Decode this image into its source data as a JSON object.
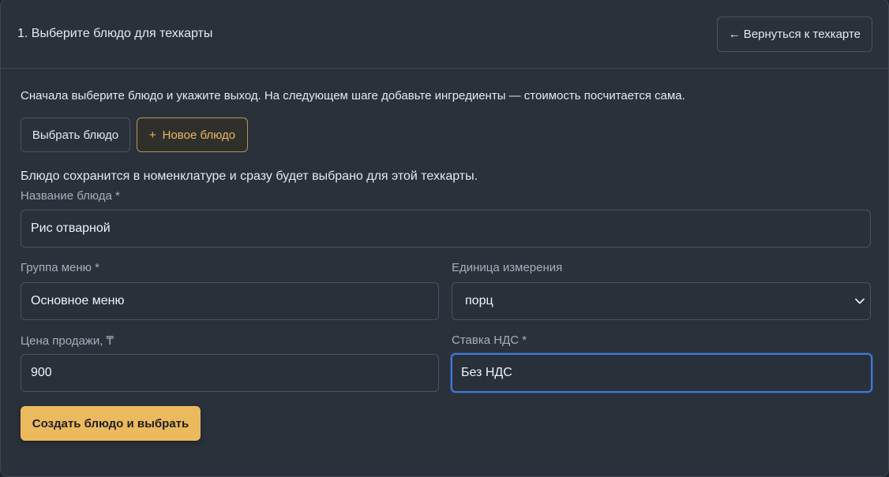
{
  "header": {
    "title": "1. Выберите блюдо для техкарты",
    "back_label": "← Вернуться к техкарте"
  },
  "hint": "Сначала выберите блюдо и укажите выход. На следующем шаге добавьте ингредиенты — стоимость посчитается сама.",
  "actions": {
    "select_label": "Выбрать блюдо",
    "new_icon": "+",
    "new_label": "Новое блюдо"
  },
  "note": "Блюдо сохранится в номенклатуре и сразу будет выбрано для этой техкарты.",
  "form": {
    "name_label": "Название блюда *",
    "name_value": "Рис отварной",
    "group_label": "Группа меню *",
    "group_value": "Основное меню",
    "unit_label": "Единица измерения",
    "unit_value": "порц",
    "price_label": "Цена продажи, ₸",
    "price_value": "900",
    "vat_label": "Ставка НДС *",
    "vat_value": "Без НДС",
    "submit_label": "Создать блюдо и выбрать"
  },
  "colors": {
    "accent": "#ebb95e",
    "focus": "#3d7ad6",
    "background": "#2a313b"
  },
  "icons": {
    "unit_select": "chevron-down-icon"
  }
}
